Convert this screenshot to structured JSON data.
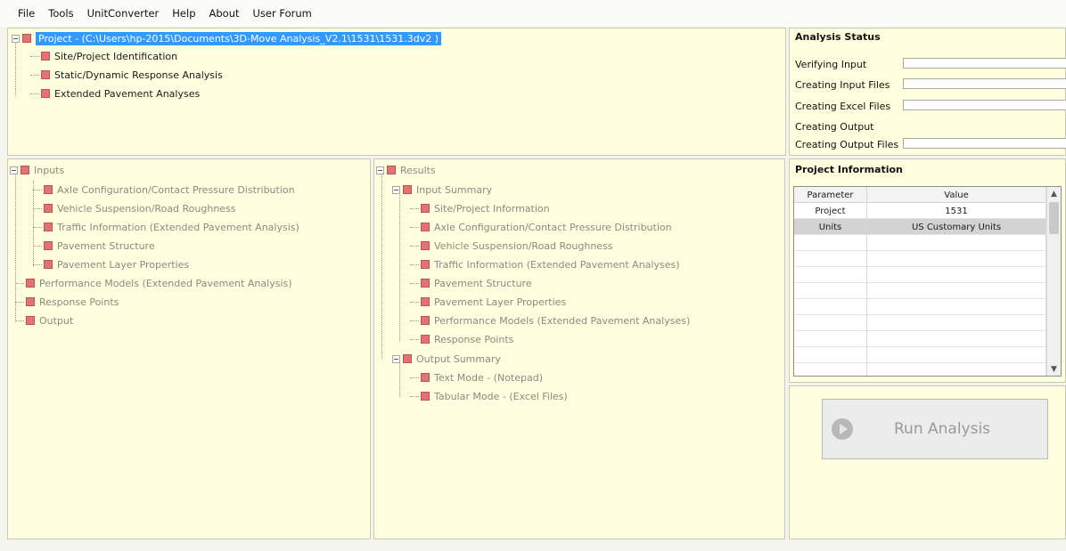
{
  "menu": [
    "File",
    "Tools",
    "UnitConverter",
    "Help",
    "About",
    "User Forum"
  ],
  "project_tree": {
    "root": "Project - (C:\\Users\\hp-2015\\Documents\\3D-Move Analysis_V2.1\\1531\\1531.3dv2 )",
    "children": [
      "Site/Project Identification",
      "Static/Dynamic Response Analysis",
      "Extended Pavement Analyses"
    ]
  },
  "inputs_tree": {
    "root": "Inputs",
    "children": [
      "Axle Configuration/Contact Pressure Distribution",
      "Vehicle  Suspension/Road Roughness",
      "Traffic Information (Extended Pavement Analysis)",
      "Pavement Structure",
      "Pavement Layer Properties"
    ],
    "siblings": [
      "Performance Models (Extended Pavement Analysis)",
      "Response Points",
      "Output"
    ]
  },
  "results_tree": {
    "root": "Results",
    "input_summary": "Input Summary",
    "input_items": [
      "Site/Project Information",
      "Axle Configuration/Contact Pressure Distribution",
      "Vehicle Suspension/Road Roughness",
      "Traffic Information (Extended Pavement Analyses)",
      "Pavement Structure",
      "Pavement Layer Properties",
      "Performance Models (Extended Pavement Analyses)",
      "Response Points"
    ],
    "output_summary": "Output Summary",
    "output_items": [
      "Text Mode - (Notepad)",
      "Tabular Mode - (Excel Files)"
    ]
  },
  "analysis_status": {
    "title": "Analysis Status",
    "items": [
      "Verifying Input",
      "Creating Input Files",
      "Creating Excel Files",
      "Creating Output",
      "Creating Output Files"
    ]
  },
  "project_info": {
    "title": "Project Information",
    "columns": [
      "Parameter",
      "Value"
    ],
    "rows": [
      [
        "Project",
        "1531"
      ],
      [
        "Units",
        "US Customary Units"
      ]
    ]
  },
  "run_button": {
    "label": "Run Analysis"
  },
  "icons": {
    "node": "red-square-icon",
    "expander": "minus-box-icon",
    "run": "play-circle-icon"
  },
  "colors": {
    "panel_bg": "#ffffe0",
    "node_icon": "#e07474",
    "selection": "#3399ff"
  }
}
